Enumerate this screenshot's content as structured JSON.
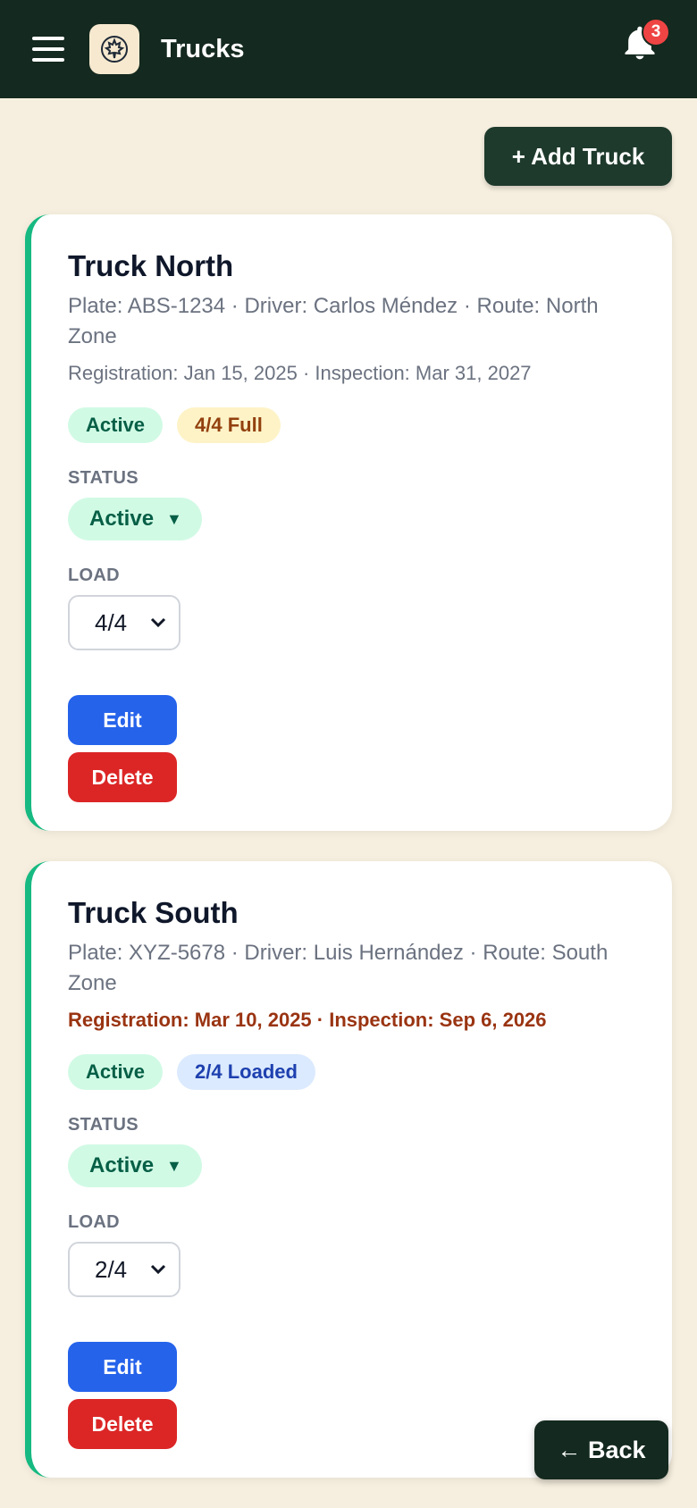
{
  "header": {
    "title": "Trucks",
    "notifications_count": "3",
    "menu_icon": "hamburger-menu-icon",
    "logo_icon": "maple-leaf-icon",
    "bell_icon": "bell-icon"
  },
  "toolbar": {
    "add_label": "+ Add Truck"
  },
  "labels": {
    "status": "STATUS",
    "load": "LOAD"
  },
  "trucks": [
    {
      "name": "Truck North",
      "meta": "Plate: ABS-1234 · Driver: Carlos Méndez · Route: North Zone",
      "dates": "Registration: Jan 15, 2025 · Inspection: Mar 31, 2027",
      "status_chip": "Active",
      "load_chip": "4/4 Full",
      "status_value": "Active",
      "load_value": "4/4",
      "edit_label": "Edit",
      "delete_label": "Delete"
    },
    {
      "name": "Truck South",
      "meta": "Plate: XYZ-5678 · Driver: Luis Hernández · Route: South Zone",
      "dates": "Registration: Mar 10, 2025 · Inspection: Sep 6, 2026",
      "status_chip": "Active",
      "load_chip": "2/4 Loaded",
      "status_value": "Active",
      "load_value": "2/4",
      "edit_label": "Edit",
      "delete_label": "Delete"
    }
  ],
  "footer": {
    "back_label": "← Back"
  },
  "colors": {
    "header_bg": "#14291f",
    "accent_green": "#16b981",
    "edit_blue": "#2563eb",
    "delete_red": "#dc2626",
    "warning_text": "#9a3412"
  }
}
